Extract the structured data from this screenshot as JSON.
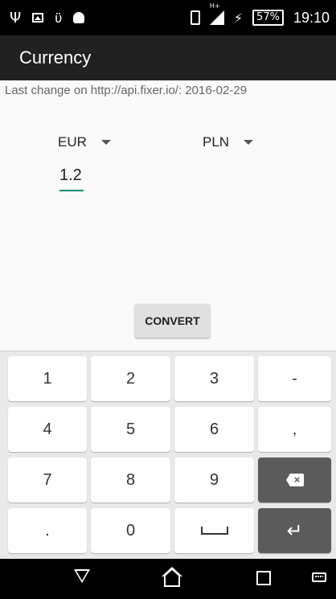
{
  "status_bar": {
    "time": "19:10",
    "battery_percent": "57%",
    "network_label": "H+",
    "icons": [
      "usb-icon",
      "image-notification-icon",
      "bulb-icon",
      "android-icon",
      "vibrate-icon",
      "signal-icon",
      "charging-icon",
      "battery-icon"
    ]
  },
  "app": {
    "title": "Currency"
  },
  "main": {
    "last_change": "Last change on http://api.fixer.io/: 2016-02-29",
    "from_currency": "EUR",
    "to_currency": "PLN",
    "amount": "1.2",
    "convert_label": "CONVERT",
    "accent_color": "#00897b"
  },
  "keyboard": {
    "rows": [
      [
        "1",
        "2",
        "3",
        "-"
      ],
      [
        "4",
        "5",
        "6",
        ","
      ],
      [
        "7",
        "8",
        "9",
        "backspace-icon"
      ],
      [
        ".",
        "0",
        "space-icon",
        "enter-icon"
      ]
    ],
    "enter_glyph": "↵"
  },
  "nav_bar": {
    "icons": [
      "back-icon",
      "home-icon",
      "recents-icon",
      "keyboard-switch-icon"
    ]
  }
}
